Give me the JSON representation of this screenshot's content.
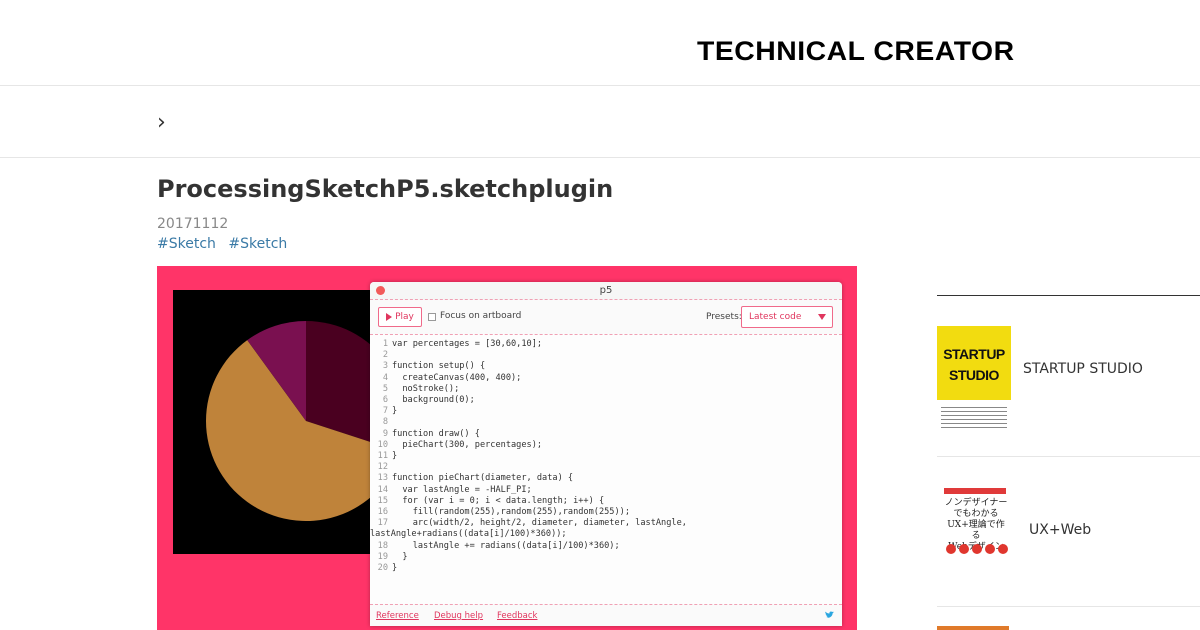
{
  "header": {
    "logo_text": "TECHNICAL CREATOR"
  },
  "breadcrumb": {
    "chevron": "›"
  },
  "post": {
    "title": "ProcessingSketchP5.sketchplugin",
    "date": "20171112",
    "tags": [
      "#Sketch",
      "#Sketch"
    ]
  },
  "p5_window": {
    "title": "p5",
    "play_label": "Play",
    "focus_label": "Focus on artboard",
    "presets_label": "Presets:",
    "preset_value": "Latest code",
    "footer_links": [
      "Reference",
      "Debug help",
      "Feedback"
    ]
  },
  "code_lines": [
    {
      "n": "1",
      "t": "var percentages = [30,60,10];"
    },
    {
      "n": "2",
      "t": ""
    },
    {
      "n": "3",
      "t": "function setup() {"
    },
    {
      "n": "4",
      "t": "  createCanvas(400, 400);"
    },
    {
      "n": "5",
      "t": "  noStroke();"
    },
    {
      "n": "6",
      "t": "  background(0);"
    },
    {
      "n": "7",
      "t": "}"
    },
    {
      "n": "8",
      "t": ""
    },
    {
      "n": "9",
      "t": "function draw() {"
    },
    {
      "n": "10",
      "t": "  pieChart(300, percentages);"
    },
    {
      "n": "11",
      "t": "}"
    },
    {
      "n": "12",
      "t": ""
    },
    {
      "n": "13",
      "t": "function pieChart(diameter, data) {"
    },
    {
      "n": "14",
      "t": "  var lastAngle = -HALF_PI;"
    },
    {
      "n": "15",
      "t": "  for (var i = 0; i < data.length; i++) {"
    },
    {
      "n": "16",
      "t": "    fill(random(255),random(255),random(255));"
    },
    {
      "n": "17",
      "t": "    arc(width/2, height/2, diameter, diameter, lastAngle,"
    },
    {
      "n": "",
      "t": "lastAngle+radians((data[i]/100)*360));"
    },
    {
      "n": "18",
      "t": "    lastAngle += radians((data[i]/100)*360);"
    },
    {
      "n": "19",
      "t": "  }"
    },
    {
      "n": "20",
      "t": "}"
    }
  ],
  "pie": {
    "percentages": [
      30,
      60,
      10
    ],
    "colors": [
      "#4a0020",
      "#bf833a",
      "#7a1050"
    ]
  },
  "sidebar": {
    "items": [
      {
        "label": "STARTUP STUDIO",
        "cover_title": "STARTUP\nSTUDIO"
      },
      {
        "label": "UX+Web",
        "cover_title": "ノンデザイナーでもわかる\nUX+理論で作る\nWebデザイン"
      }
    ]
  },
  "colors": {
    "hero_bg": "#ff3468",
    "accent": "#e0365e",
    "tag": "#3a7aa6"
  }
}
